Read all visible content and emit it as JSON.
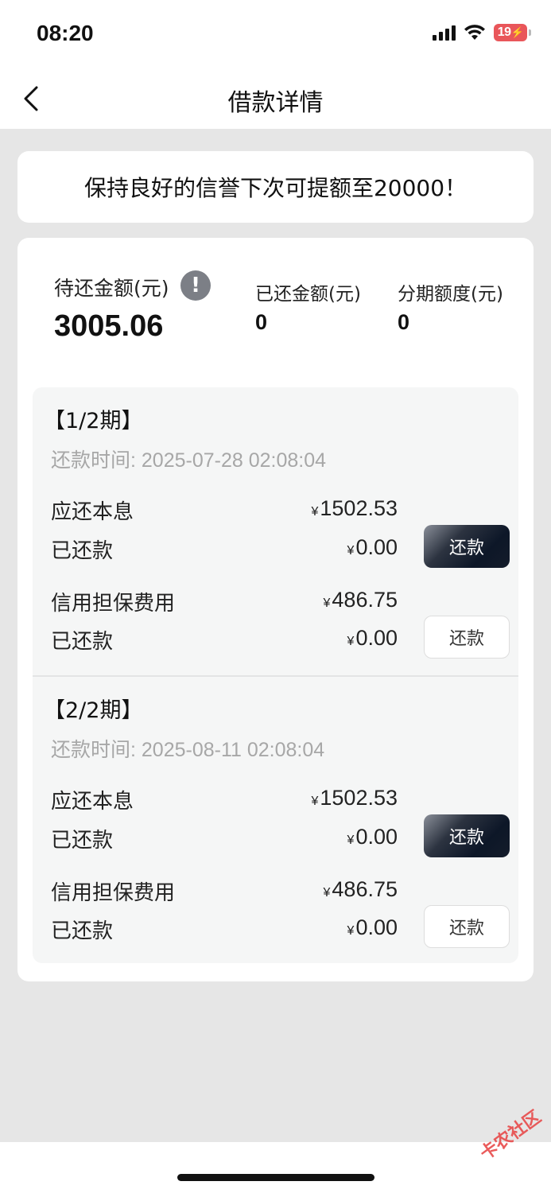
{
  "status_bar": {
    "time": "08:20",
    "battery": "19"
  },
  "nav": {
    "title": "借款详情"
  },
  "notice": {
    "text": "保持良好的信誉下次可提额至20000！"
  },
  "summary": {
    "pending_label": "待还金额(元)",
    "pending_value": "3005.06",
    "paid_label": "已还金额(元)",
    "paid_value": "0",
    "quota_label": "分期额度(元)",
    "quota_value": "0"
  },
  "currency_symbol": "¥",
  "periods": [
    {
      "title": "【1/2期】",
      "due_time": "还款时间: 2025-07-28 02:08:04",
      "principal_label": "应还本息",
      "principal_amount": "1502.53",
      "principal_paid_label": "已还款",
      "principal_paid_amount": "0.00",
      "principal_button": "还款",
      "fee_label": "信用担保费用",
      "fee_amount": "486.75",
      "fee_paid_label": "已还款",
      "fee_paid_amount": "0.00",
      "fee_button": "还款"
    },
    {
      "title": "【2/2期】",
      "due_time": "还款时间: 2025-08-11 02:08:04",
      "principal_label": "应还本息",
      "principal_amount": "1502.53",
      "principal_paid_label": "已还款",
      "principal_paid_amount": "0.00",
      "principal_button": "还款",
      "fee_label": "信用担保费用",
      "fee_amount": "486.75",
      "fee_paid_label": "已还款",
      "fee_paid_amount": "0.00",
      "fee_button": "还款"
    }
  ],
  "watermark": "卡农社区"
}
